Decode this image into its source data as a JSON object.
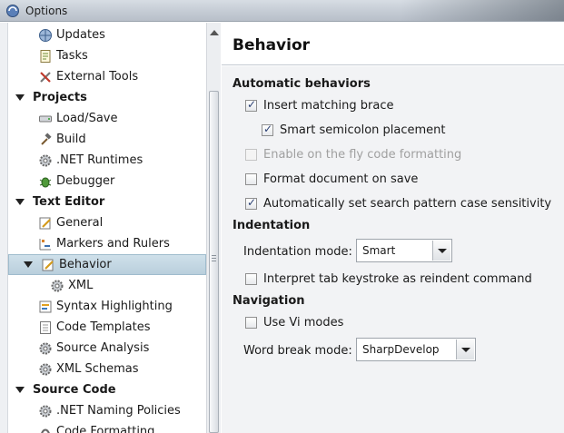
{
  "window": {
    "title": "Options"
  },
  "tree": {
    "items": [
      {
        "label": "Updates",
        "icon": "globe-icon",
        "level": 1
      },
      {
        "label": "Tasks",
        "icon": "tasks-icon",
        "level": 1
      },
      {
        "label": "External Tools",
        "icon": "tools-icon",
        "level": 1
      },
      {
        "label": "Projects",
        "icon": "",
        "level": 0
      },
      {
        "label": "Load/Save",
        "icon": "drive-icon",
        "level": 1
      },
      {
        "label": "Build",
        "icon": "hammer-icon",
        "level": 1
      },
      {
        "label": ".NET Runtimes",
        "icon": "gear-icon",
        "level": 1
      },
      {
        "label": "Debugger",
        "icon": "bug-icon",
        "level": 1
      },
      {
        "label": "Text Editor",
        "icon": "",
        "level": 0
      },
      {
        "label": "General",
        "icon": "edit-icon",
        "level": 1
      },
      {
        "label": "Markers and Rulers",
        "icon": "markers-icon",
        "level": 1
      },
      {
        "label": "Behavior",
        "icon": "edit-icon",
        "level": 1,
        "selected": true
      },
      {
        "label": "XML",
        "icon": "gear-icon",
        "level": 2
      },
      {
        "label": "Syntax Highlighting",
        "icon": "highlight-icon",
        "level": 1
      },
      {
        "label": "Code Templates",
        "icon": "template-icon",
        "level": 1
      },
      {
        "label": "Source Analysis",
        "icon": "gear-icon",
        "level": 1
      },
      {
        "label": "XML Schemas",
        "icon": "gear-icon",
        "level": 1
      },
      {
        "label": "Source Code",
        "icon": "",
        "level": 0
      },
      {
        "label": ".NET Naming Policies",
        "icon": "gear-icon",
        "level": 1
      },
      {
        "label": "Code Formatting",
        "icon": "format-icon",
        "level": 1
      }
    ]
  },
  "panel": {
    "title": "Behavior",
    "automatic": {
      "heading": "Automatic behaviors",
      "insert_matching_brace": {
        "label": "Insert matching brace",
        "checked": true
      },
      "smart_semicolon": {
        "label": "Smart semicolon placement",
        "checked": true
      },
      "on_the_fly": {
        "label": "Enable on the fly code formatting",
        "checked": false,
        "disabled": true
      },
      "format_on_save": {
        "label": "Format document on save",
        "checked": false
      },
      "search_case": {
        "label": "Automatically set search pattern case sensitivity",
        "checked": true
      }
    },
    "indentation": {
      "heading": "Indentation",
      "mode_label": "Indentation mode:",
      "mode_value": "Smart",
      "tab_reindent": {
        "label": "Interpret tab keystroke as reindent command",
        "checked": false
      }
    },
    "navigation": {
      "heading": "Navigation",
      "vi_modes": {
        "label": "Use Vi modes",
        "checked": false
      },
      "word_break_label": "Word break mode:",
      "word_break_value": "SharpDevelop"
    }
  },
  "colors": {
    "selection": "#c5d8e3",
    "panel_bg": "#f2f3f5",
    "check": "#2a3f73"
  }
}
